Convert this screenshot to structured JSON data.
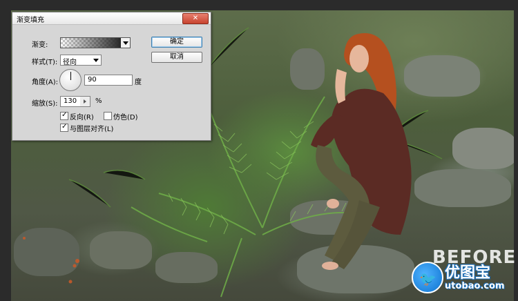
{
  "dialog": {
    "title": "渐变填充",
    "close_label": "✕",
    "gradient_label": "渐变:",
    "style_label": "样式(T):",
    "style_value": "径向",
    "angle_label": "角度(A):",
    "angle_value": "90",
    "angle_unit": "度",
    "scale_label": "缩放(S):",
    "scale_value": "130",
    "scale_unit": "%",
    "reverse_label": "反向(R)",
    "reverse_checked": true,
    "dither_label": "仿色(D)",
    "dither_checked": false,
    "align_label": "与图层对齐(L)",
    "align_checked": true,
    "ok_label": "确定",
    "cancel_label": "取消",
    "checkmark": "✓"
  },
  "watermark": {
    "before_text": "BEFORE",
    "site_name": "优图宝",
    "site_url": "utobao.com",
    "bird_glyph": "🐦"
  },
  "colors": {
    "close_button": "#c7432f",
    "primary_button_border": "#3c7fb1",
    "watermark_blue": "#1a7fd9"
  }
}
